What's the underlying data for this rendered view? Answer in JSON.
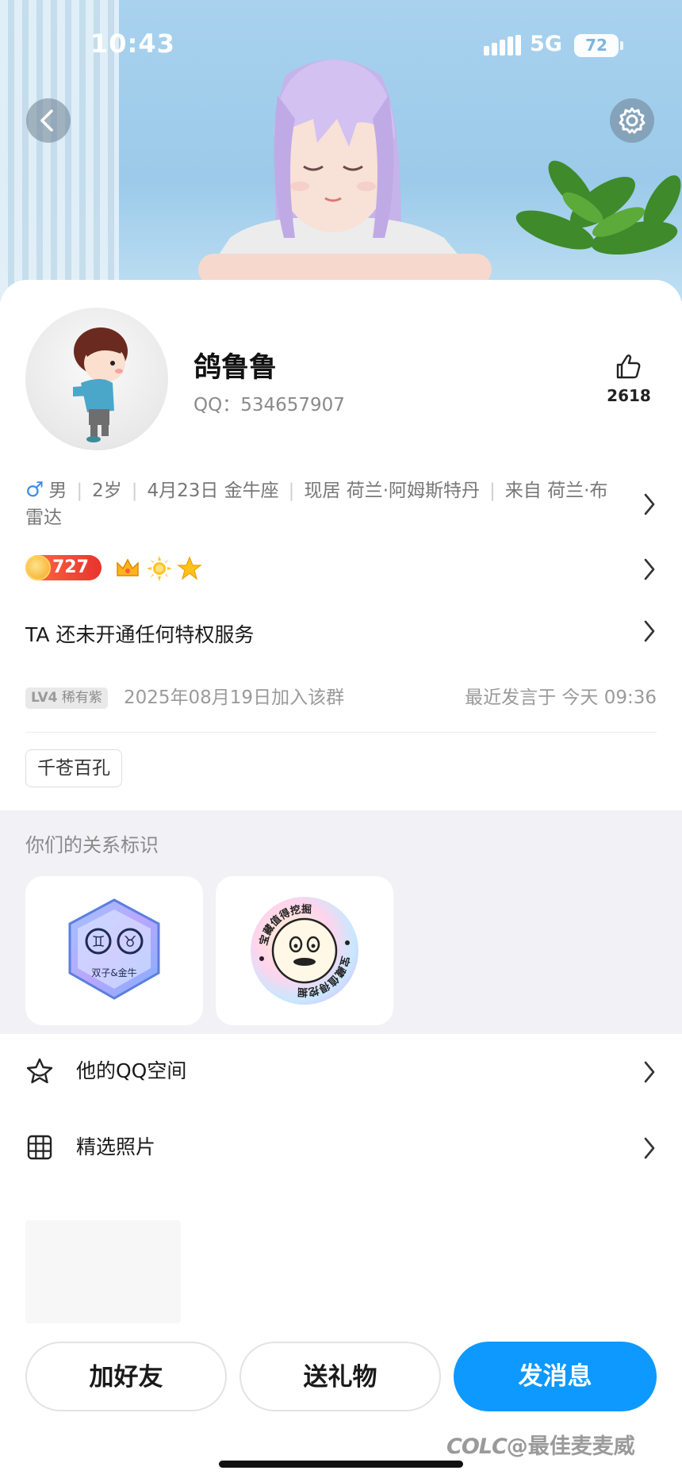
{
  "status_bar": {
    "time": "10:43",
    "network": "5G",
    "battery": "72"
  },
  "profile": {
    "nickname": "鸽鲁鲁",
    "qq_label": "QQ：534657907",
    "likes": "2618"
  },
  "info": {
    "gender": "男",
    "age": "2岁",
    "birthday": "4月23日 金牛座",
    "location": "现居 荷兰·阿姆斯特丹",
    "hometown": "来自 荷兰·布雷达"
  },
  "badges": {
    "coins": "727",
    "icons": [
      "crown-icon",
      "sun-icon",
      "star-icon"
    ]
  },
  "privilege_text": "TA 还未开通任何特权服务",
  "group": {
    "level": "LV4",
    "level_title": "稀有紫",
    "joined": "2025年08月19日加入该群",
    "last_speak": "最近发言于 今天 09:36"
  },
  "tag": "千苍百孔",
  "relation": {
    "title": "你们的关系标识",
    "cards": [
      {
        "caption": "双子&金牛",
        "symbols": [
          "♊",
          "♉"
        ]
      },
      {
        "ring_text": "宝藏值得挖掘"
      }
    ]
  },
  "menu": [
    {
      "label": "他的QQ空间",
      "icon": "star-outline-icon"
    },
    {
      "label": "精选照片",
      "icon": "grid-icon"
    }
  ],
  "actions": {
    "add_friend": "加好友",
    "send_gift": "送礼物",
    "send_message": "发消息"
  },
  "watermark": "@最佳麦麦威",
  "colors": {
    "primary": "#0d99ff",
    "male": "#3d8ee6",
    "coin": "#e8332c"
  }
}
